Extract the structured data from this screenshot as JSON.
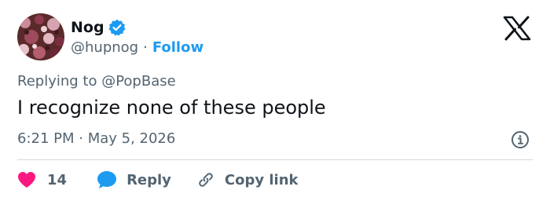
{
  "author": {
    "display_name": "Nog",
    "handle": "@hupnog",
    "separator": "·",
    "follow_label": "Follow",
    "verified_icon": "verified-badge-icon"
  },
  "brand": {
    "logo_icon": "x-logo-icon"
  },
  "tweet": {
    "replying_to": "Replying to @PopBase",
    "text": "I recognize none of these people",
    "timestamp": "6:21 PM · May 5, 2026"
  },
  "actions": {
    "like_count": "14",
    "reply_label": "Reply",
    "copy_link_label": "Copy link"
  },
  "colors": {
    "text_primary": "#0f1419",
    "text_secondary": "#536471",
    "accent_blue": "#1d9bf0",
    "like_red": "#f91880",
    "divider": "#cfd9de"
  }
}
